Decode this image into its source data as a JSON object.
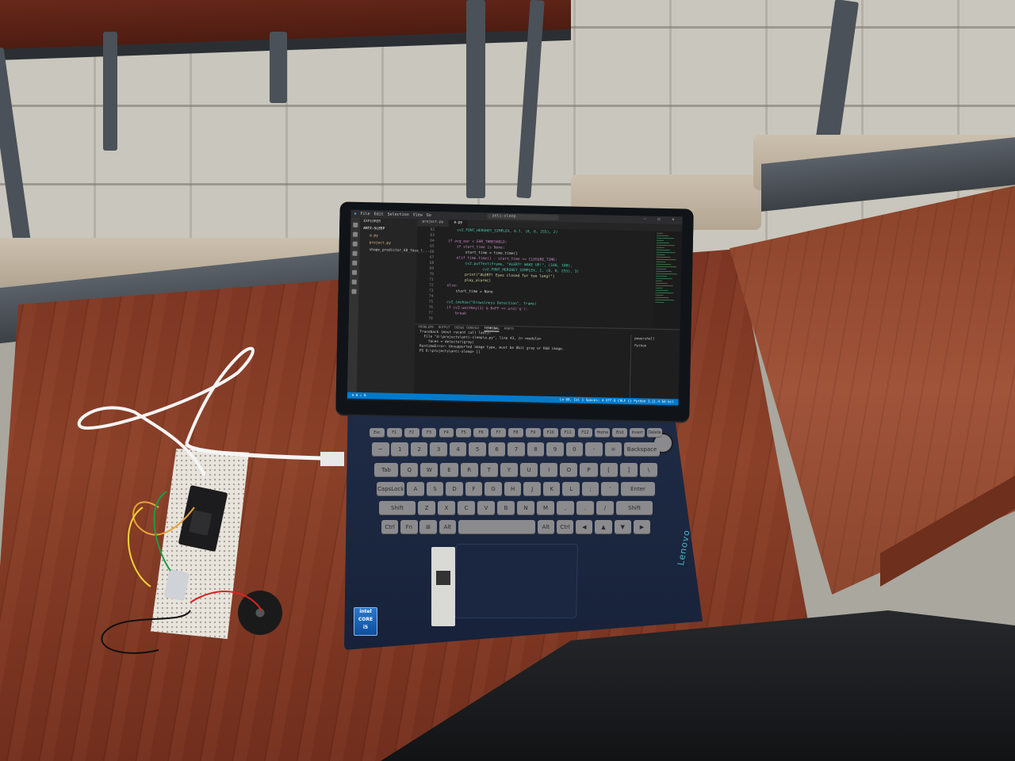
{
  "scene": {
    "description_tags": [
      "laptop",
      "breadboard",
      "buzzer",
      "desk"
    ]
  },
  "window": {
    "menu": [
      "File",
      "Edit",
      "Selection",
      "View",
      "Go"
    ],
    "search": "anti-sleep",
    "tabs": [
      "project.py",
      "a.py"
    ]
  },
  "explorer": {
    "header": "EXPLORER",
    "folder": "ANTI-SLEEP",
    "files": [
      "a.py",
      "project.py",
      "shape_predictor_68_face_l..."
    ]
  },
  "editor": {
    "line_numbers": [
      "62",
      "63",
      "64",
      "65",
      "66",
      "67",
      "68",
      "69",
      "70",
      "71",
      "72",
      "73",
      "74",
      "75",
      "76",
      "77",
      "78"
    ],
    "lines": [
      "        cv2.FONT_HERSHEY_SIMPLEX, 0.7, (0, 0, 255), 2)",
      "",
      "    if avg_ear < EAR_THRESHOLD:",
      "        if start_time is None:",
      "            start_time = time.time()",
      "        elif time.time() - start_time >= CLOSURE_TIME:",
      "            cv2.putText(frame, \"ALERT! WAKE UP!\", (100, 100),",
      "                    cv2.FONT_HERSHEY_SIMPLEX, 1, (0, 0, 255), 3)",
      "            print(\"ALERT! Eyes closed for too long!\")",
      "            play_alarm()",
      "    else:",
      "        start_time = None",
      "",
      "    cv2.imshow(\"Drowsiness Detection\", frame)",
      "    if cv2.waitKey(1) & 0xFF == ord('q'):",
      "        break",
      ""
    ]
  },
  "panel": {
    "tabs": [
      "PROBLEMS",
      "OUTPUT",
      "DEBUG CONSOLE",
      "TERMINAL",
      "PORTS"
    ],
    "active_tab": "TERMINAL",
    "terminal_lines": [
      "Traceback (most recent call last):",
      "  File \"d:\\projects\\anti-sleep\\a.py\", line 43, in <module>",
      "    faces = detector(gray)",
      "RuntimeError: Unsupported image type, must be 8bit gray or RGB image.",
      "PS D:\\projects\\anti-sleep> []"
    ],
    "terminal_list": [
      "powershell",
      "Python"
    ]
  },
  "status": {
    "left": "⊗ 0 ⚠ 0",
    "right": "Ln 60, Col 1   Spaces: 4   UTF-8   CRLF   {} Python   3.11.4 64-bit"
  },
  "keyboard": {
    "rows": [
      [
        "Esc",
        "F1",
        "F2",
        "F3",
        "F4",
        "F5",
        "F6",
        "F7",
        "F8",
        "F9",
        "F10",
        "F11",
        "F12",
        "Home",
        "End",
        "Insert",
        "Delete"
      ],
      [
        "~",
        "1",
        "2",
        "3",
        "4",
        "5",
        "6",
        "7",
        "8",
        "9",
        "0",
        "-",
        "=",
        "Backspace"
      ],
      [
        "Tab",
        "Q",
        "W",
        "E",
        "R",
        "T",
        "Y",
        "U",
        "I",
        "O",
        "P",
        "[",
        "]",
        "\\"
      ],
      [
        "CapsLock",
        "A",
        "S",
        "D",
        "F",
        "G",
        "H",
        "J",
        "K",
        "L",
        ";",
        "'",
        "Enter"
      ],
      [
        "Shift",
        "Z",
        "X",
        "C",
        "V",
        "B",
        "N",
        "M",
        ",",
        ".",
        "/",
        "Shift"
      ],
      [
        "Ctrl",
        "Fn",
        "⊞",
        "Alt",
        "",
        "Alt",
        "Ctrl",
        "◀",
        "▲",
        "▼",
        "▶"
      ]
    ]
  },
  "badges": {
    "intel": "CORE",
    "intel_top": "intel",
    "intel_gen": "i5",
    "brand": "Lenovo"
  }
}
